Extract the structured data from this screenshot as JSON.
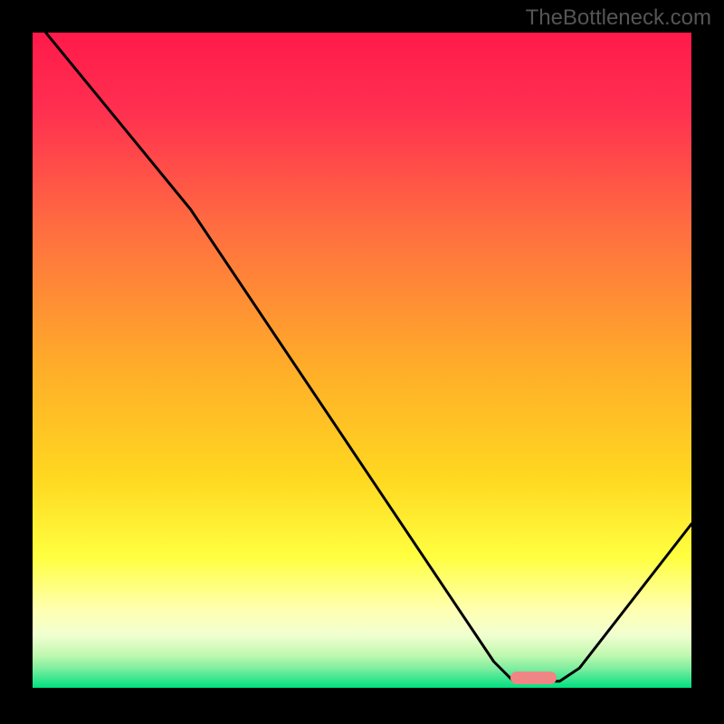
{
  "watermark": "TheBottleneck.com",
  "accent_colors": {
    "marker": "#f08585",
    "curve": "#000000"
  },
  "chart_data": {
    "type": "line",
    "title": "",
    "xlabel": "",
    "ylabel": "",
    "xlim": [
      0,
      100
    ],
    "ylim": [
      0,
      100
    ],
    "gradient_stops": [
      {
        "offset": 0,
        "color": "#ff1a4a"
      },
      {
        "offset": 12,
        "color": "#ff3050"
      },
      {
        "offset": 30,
        "color": "#ff6e40"
      },
      {
        "offset": 50,
        "color": "#ffaa2a"
      },
      {
        "offset": 68,
        "color": "#ffd820"
      },
      {
        "offset": 80,
        "color": "#ffff40"
      },
      {
        "offset": 88,
        "color": "#ffffb0"
      },
      {
        "offset": 92,
        "color": "#f0ffd0"
      },
      {
        "offset": 95,
        "color": "#c0f8b0"
      },
      {
        "offset": 97,
        "color": "#80eea0"
      },
      {
        "offset": 100,
        "color": "#00e080"
      }
    ],
    "series": [
      {
        "name": "bottleneck-curve",
        "points": [
          {
            "x": 2,
            "y": 100
          },
          {
            "x": 24,
            "y": 73
          },
          {
            "x": 70,
            "y": 4
          },
          {
            "x": 73,
            "y": 1
          },
          {
            "x": 80,
            "y": 1
          },
          {
            "x": 83,
            "y": 3
          },
          {
            "x": 100,
            "y": 25
          }
        ]
      }
    ],
    "marker": {
      "x": 76,
      "y": 1.5,
      "width_pct": 7
    }
  }
}
